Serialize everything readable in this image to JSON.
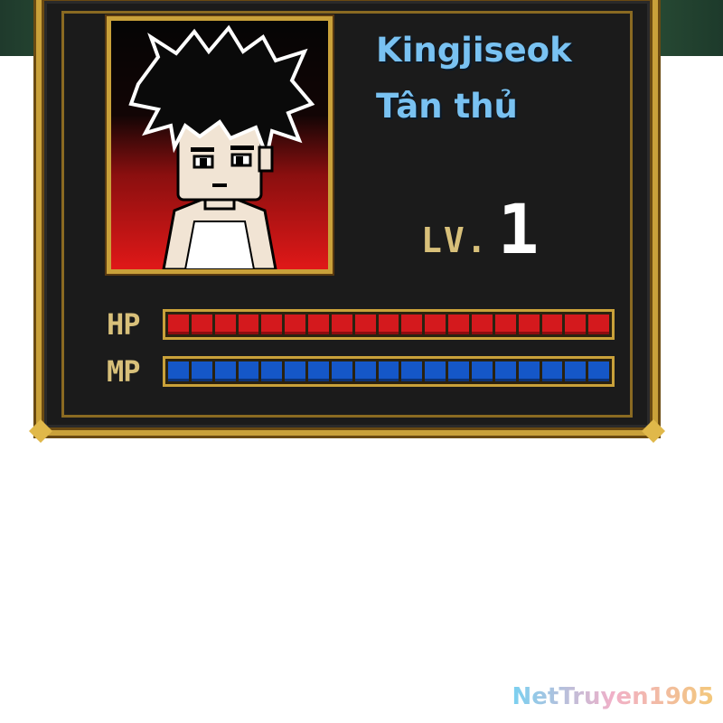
{
  "character": {
    "name": "Kingjiseok",
    "title": "Tân thủ",
    "level_label": "LV.",
    "level": "1"
  },
  "stats": {
    "hp": {
      "label": "HP",
      "fraction": 1.0,
      "cells": 19,
      "color": "#d4191d"
    },
    "mp": {
      "label": "MP",
      "fraction": 1.0,
      "cells": 19,
      "color": "#1557c8"
    }
  },
  "watermark": "NetTruyen1905",
  "colors": {
    "frame_gold": "#c9a13a",
    "name_text": "#79c2f2",
    "label_text": "#d8c07a",
    "panel_bg": "#1b1b1b"
  }
}
